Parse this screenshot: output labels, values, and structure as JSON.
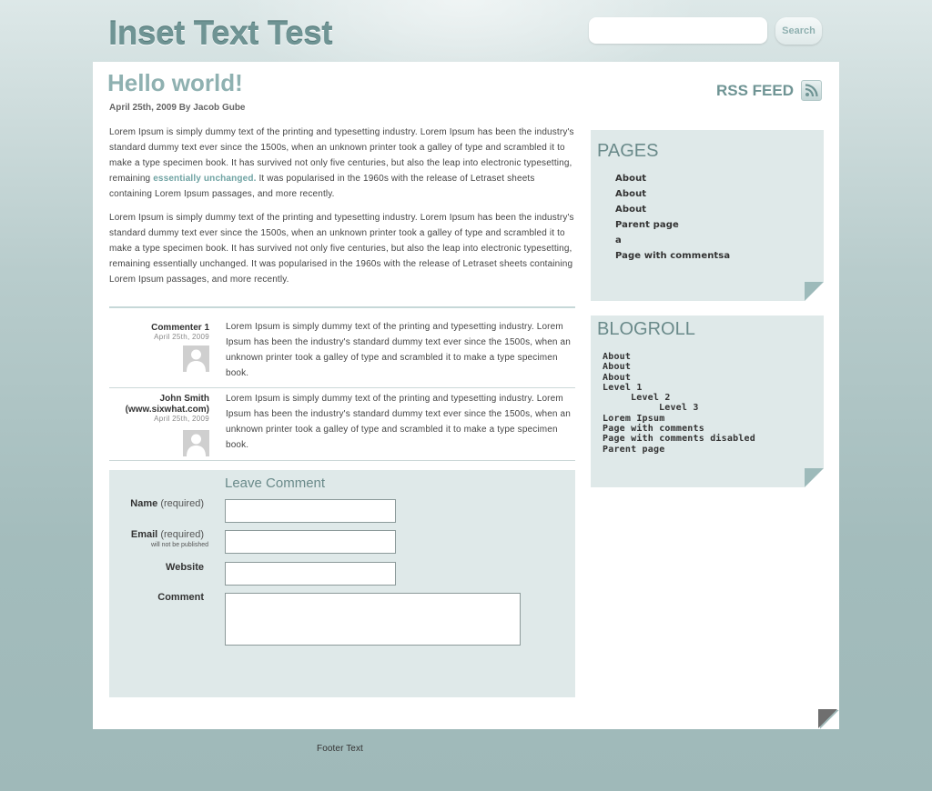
{
  "header": {
    "site_title": "Inset Text Test",
    "search": {
      "placeholder": "",
      "value": "",
      "button_label": "Search"
    }
  },
  "post": {
    "title": "Hello world!",
    "meta": "April 25th, 2009 By Jacob Gube",
    "rss_label": "RSS FEED",
    "paragraphs": [
      {
        "before_link": "Lorem Ipsum is simply dummy text of the printing and typesetting industry. Lorem Ipsum has been the industry's standard dummy text ever since the 1500s, when an unknown printer took a galley of type and scrambled it to make a type specimen book. It has survived not only five centuries, but also the leap into electronic typesetting, remaining ",
        "link": "essentially unchanged.",
        "after_link": " It was popularised in the 1960s with the release of Letraset sheets containing Lorem Ipsum passages, and more recently."
      },
      {
        "text": "Lorem Ipsum is simply dummy text of the printing and typesetting industry. Lorem Ipsum has been the industry's standard dummy text ever since the 1500s, when an unknown printer took a galley of type and scrambled it to make a type specimen book. It has survived not only five centuries, but also the leap into electronic typesetting, remaining essentially unchanged. It was popularised in the 1960s with the release of Letraset sheets containing Lorem Ipsum passages, and more recently."
      }
    ]
  },
  "comments": [
    {
      "author": "Commenter 1",
      "date": "April 25th, 2009",
      "text": "Lorem Ipsum is simply dummy text of the printing and typesetting industry. Lorem Ipsum has been the industry's standard dummy text ever since the 1500s, when an unknown printer took a galley of type and scrambled it to make a type specimen book."
    },
    {
      "author_line1": "John Smith",
      "author_line2": "(www.sixwhat.com)",
      "date": "April 25th, 2009",
      "text": "Lorem Ipsum is simply dummy text of the printing and typesetting industry. Lorem Ipsum has been the industry's standard dummy text ever since the 1500s, when an unknown printer took a galley of type and scrambled it to make a type specimen book."
    }
  ],
  "comment_form": {
    "heading": "Leave Comment",
    "name_label": "Name",
    "name_req": "(required)",
    "email_label": "Email",
    "email_req": "(required)",
    "email_note": "will not be published",
    "website_label": "Website",
    "comment_label": "Comment",
    "name_value": "",
    "email_value": "",
    "website_value": "",
    "comment_value": ""
  },
  "sidebar": {
    "pages": {
      "title": "PAGES",
      "items": [
        "About",
        "About",
        "About",
        "Parent page",
        "a",
        "Page with commentsa"
      ]
    },
    "blogroll": {
      "title": "BLOGROLL",
      "items": [
        {
          "label": "About",
          "level": 1
        },
        {
          "label": "About",
          "level": 1
        },
        {
          "label": "About",
          "level": 1
        },
        {
          "label": "Level 1",
          "level": 1
        },
        {
          "label": "Level 2",
          "level": 2
        },
        {
          "label": "Level 3",
          "level": 3
        },
        {
          "label": "Lorem Ipsum",
          "level": 1
        },
        {
          "label": "Page with comments",
          "level": 1
        },
        {
          "label": "Page with comments disabled",
          "level": 1
        },
        {
          "label": "Parent page",
          "level": 1
        }
      ]
    }
  },
  "footer": {
    "text": "Footer Text"
  },
  "colors": {
    "accent": "#6f9494",
    "link": "#6fa3a3",
    "panel": "#dfe9e9",
    "background": "#a3bcbc"
  }
}
